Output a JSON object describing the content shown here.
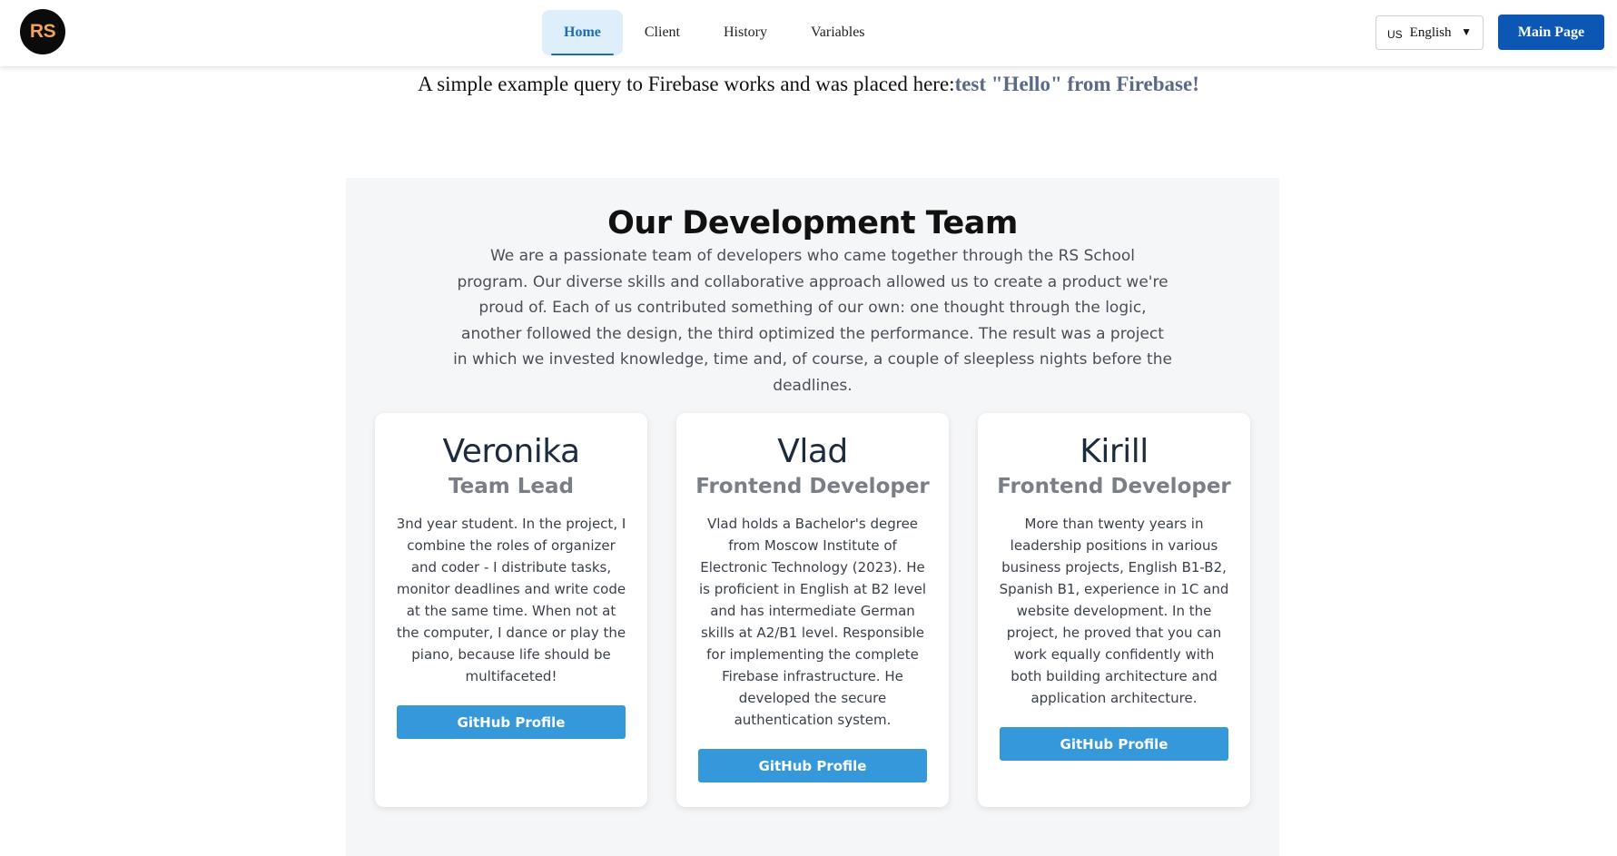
{
  "header": {
    "logo_text": "RS",
    "nav": [
      {
        "label": "Home",
        "active": true
      },
      {
        "label": "Client",
        "active": false
      },
      {
        "label": "History",
        "active": false
      },
      {
        "label": "Variables",
        "active": false
      }
    ],
    "language": {
      "flag": "US",
      "label": "English",
      "caret": "▼"
    },
    "main_page_label": "Main Page"
  },
  "firebase": {
    "prefix": "A simple example query to Firebase works and was placed here:",
    "value": "test \"Hello\" from Firebase!"
  },
  "team": {
    "title": "Our Development Team",
    "description": "We are a passionate team of developers who came together through the RS School program. Our diverse skills and collaborative approach allowed us to create a product we're proud of. Each of us contributed something of our own: one thought through the logic, another followed the design, the third optimized the performance. The result was a project in which we invested knowledge, time and, of course, a couple of sleepless nights before the deadlines.",
    "members": [
      {
        "name": "Veronika",
        "role": "Team Lead",
        "bio": "3nd year student. In the project, I combine the roles of organizer and coder - I distribute tasks, monitor deadlines and write code at the same time. When not at the computer, I dance or play the piano, because life should be multifaceted!",
        "button": "GitHub Profile"
      },
      {
        "name": "Vlad",
        "role": "Frontend Developer",
        "bio": "Vlad holds a Bachelor's degree from Moscow Institute of Electronic Technology (2023). He is proficient in English at B2 level and has intermediate German skills at A2/B1 level. Responsible for implementing the complete Firebase infrastructure. He developed the secure authentication system.",
        "button": "GitHub Profile"
      },
      {
        "name": "Kirill",
        "role": "Frontend Developer",
        "bio": "More than twenty years in leadership positions in various business projects, English B1-B2, Spanish B1, experience in 1C and website development. In the project, he proved that you can work equally confidently with both building architecture and application architecture.",
        "button": "GitHub Profile"
      }
    ]
  },
  "colors": {
    "accent": "#0b57b3",
    "nav_active": "#1c6fb5",
    "github_button": "#3498db",
    "firebase_value": "#5a6a86"
  }
}
